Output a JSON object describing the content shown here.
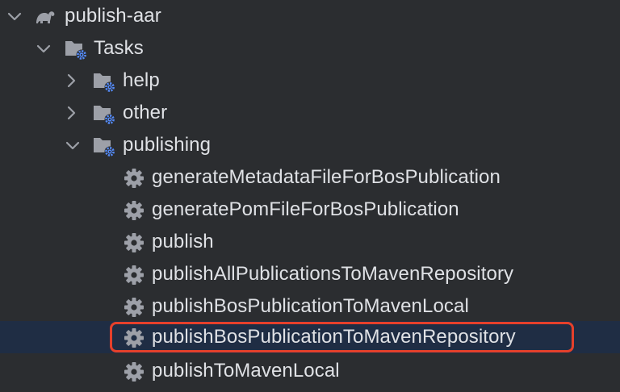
{
  "tree": {
    "root": {
      "label": "publish-aar",
      "icon": "gradle-elephant-icon",
      "expanded": true
    },
    "tasks": {
      "label": "Tasks",
      "icon": "folder-gear-icon",
      "expanded": true
    },
    "groups": [
      {
        "label": "help",
        "icon": "folder-gear-icon",
        "expanded": false
      },
      {
        "label": "other",
        "icon": "folder-gear-icon",
        "expanded": false
      },
      {
        "label": "publishing",
        "icon": "folder-gear-icon",
        "expanded": true
      }
    ],
    "publishing_tasks": [
      {
        "label": "generateMetadataFileForBosPublication",
        "icon": "gear-icon"
      },
      {
        "label": "generatePomFileForBosPublication",
        "icon": "gear-icon"
      },
      {
        "label": "publish",
        "icon": "gear-icon"
      },
      {
        "label": "publishAllPublicationsToMavenRepository",
        "icon": "gear-icon"
      },
      {
        "label": "publishBosPublicationToMavenLocal",
        "icon": "gear-icon"
      },
      {
        "label": "publishBosPublicationToMavenRepository",
        "icon": "gear-icon",
        "selected": true,
        "highlighted": true
      },
      {
        "label": "publishToMavenLocal",
        "icon": "gear-icon"
      }
    ]
  },
  "colors": {
    "background": "#2b2d30",
    "selection": "#1f2d44",
    "text": "#dfe1e5",
    "icon_gray": "#9da0a8",
    "gear_blue": "#548af7",
    "highlight_red": "#e5402b"
  }
}
